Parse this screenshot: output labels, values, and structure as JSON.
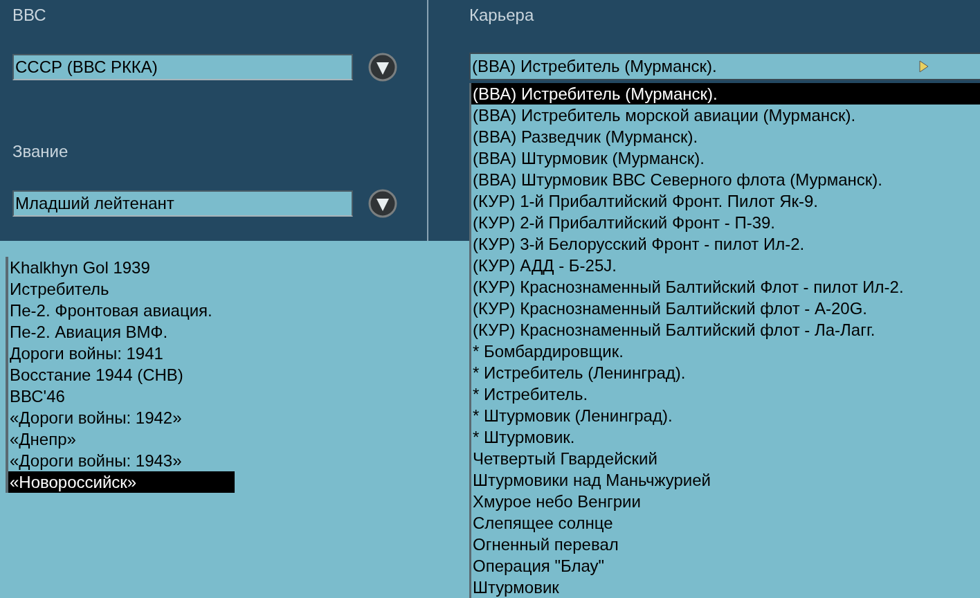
{
  "air_force": {
    "label": "ВВС",
    "value": "СССР (ВВС РККА)"
  },
  "rank": {
    "label": "Звание",
    "value": "Младший лейтенант"
  },
  "campaigns": [
    {
      "label": "Khalkhyn Gol 1939",
      "selected": false
    },
    {
      "label": "Истребитель",
      "selected": false
    },
    {
      "label": "Пе-2. Фронтовая авиация.",
      "selected": false
    },
    {
      "label": "Пе-2. Авиация ВМФ.",
      "selected": false
    },
    {
      "label": "Дороги войны: 1941",
      "selected": false
    },
    {
      "label": "Восстание 1944 (СНВ)",
      "selected": false
    },
    {
      "label": "ВВС'46",
      "selected": false
    },
    {
      "label": "«Дороги войны: 1942»",
      "selected": false
    },
    {
      "label": "«Днепр»",
      "selected": false
    },
    {
      "label": "«Дороги войны: 1943»",
      "selected": false
    },
    {
      "label": "«Новороссийск»",
      "selected": true
    }
  ],
  "career": {
    "label": "Карьера",
    "value": "(ВВА) Истребитель (Мурманск).",
    "options": [
      {
        "label": "(ВВА) Истребитель (Мурманск).",
        "selected": true
      },
      {
        "label": "(ВВА) Истребитель морской авиации (Мурманск).",
        "selected": false
      },
      {
        "label": "(ВВА) Разведчик (Мурманск).",
        "selected": false
      },
      {
        "label": "(ВВА) Штурмовик (Мурманск).",
        "selected": false
      },
      {
        "label": "(ВВА) Штурмовик ВВС Северного флота (Мурманск).",
        "selected": false
      },
      {
        "label": "(КУР) 1-й Прибалтийский Фронт. Пилот Як-9.",
        "selected": false
      },
      {
        "label": "(КУР) 2-й Прибалтийский Фронт - П-39.",
        "selected": false
      },
      {
        "label": "(КУР) 3-й Белорусский Фронт - пилот Ил-2.",
        "selected": false
      },
      {
        "label": "(КУР) АДД - Б-25J.",
        "selected": false
      },
      {
        "label": "(КУР) Краснознаменный Балтийский Флот - пилот Ил-2.",
        "selected": false
      },
      {
        "label": "(КУР) Краснознаменный Балтийский флот - А-20G.",
        "selected": false
      },
      {
        "label": "(КУР) Краснознаменный Балтийский флот - Ла-Лагг.",
        "selected": false
      },
      {
        "label": "* Бомбардировщик.",
        "selected": false
      },
      {
        "label": "* Истребитель (Ленинград).",
        "selected": false
      },
      {
        "label": "* Истребитель.",
        "selected": false
      },
      {
        "label": "* Штурмовик (Ленинград).",
        "selected": false
      },
      {
        "label": "* Штурмовик.",
        "selected": false
      },
      {
        "label": "Четвертый Гвардейский",
        "selected": false
      },
      {
        "label": "Штурмовики над Маньчжурией",
        "selected": false
      },
      {
        "label": "Хмурое небо Венгрии",
        "selected": false
      },
      {
        "label": "Слепящее солнце",
        "selected": false
      },
      {
        "label": "Огненный перевал",
        "selected": false
      },
      {
        "label": "Операция \"Блау\"",
        "selected": false
      },
      {
        "label": "Штурмовик",
        "selected": false
      }
    ]
  }
}
